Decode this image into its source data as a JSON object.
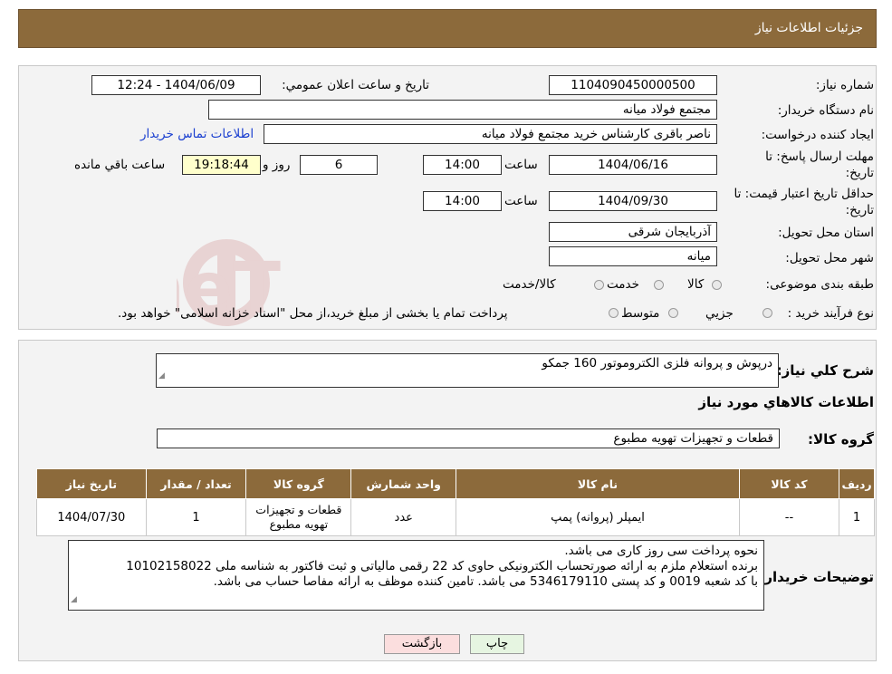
{
  "header": {
    "title": "جزئیات اطلاعات نیاز"
  },
  "form": {
    "need_number_label": "شماره نیاز:",
    "need_number": "1104090450000500",
    "announce_label": "تاریخ و ساعت اعلان عمومي:",
    "announce_value": "1404/06/09 - 12:24",
    "buyer_org_label": "نام دستگاه خريدار:",
    "buyer_org": "مجتمع فولاد میانه",
    "creator_label": "ايجاد کننده درخواست:",
    "creator": "ناصر باقری کارشناس خرید مجتمع فولاد میانه",
    "contact_link": "اطلاعات تماس خريدار",
    "deadline_label_1": "مهلت ارسال پاسخ: تا",
    "deadline_label_2": "تاريخ:",
    "deadline_date": "1404/06/16",
    "time_label": "ساعت",
    "deadline_time": "14:00",
    "days_value": "6",
    "days_label": "روز و",
    "remaining_time": "19:18:44",
    "remaining_label": "ساعت باقي مانده",
    "validity_label_1": "حداقل تاريخ اعتبار قيمت: تا",
    "validity_label_2": "تاريخ:",
    "validity_date": "1404/09/30",
    "validity_time": "14:00",
    "province_label": "استان محل تحويل:",
    "province": "آذربایجان شرقی",
    "city_label": "شهر محل تحويل:",
    "city": "میانه",
    "category_label": "طبقه بندی موضوعی:",
    "category_options": [
      "كالا",
      "خدمت",
      "كالا/خدمت"
    ],
    "process_label": "نوع فرآيند خريد :",
    "process_options": [
      "جزيي",
      "متوسط"
    ],
    "process_note": "پرداخت تمام يا بخشی از مبلغ خريد،از محل \"اسناد خزانه اسلامی\" خواهد بود."
  },
  "summary": {
    "desc_label": "شرح كلي نياز:",
    "desc": "درپوش و پروانه فلزی الکتروموتور 160 جمکو",
    "goods_info_title": "اطلاعات كالاهاي مورد نياز",
    "goods_group_label": "گروه كالا:",
    "goods_group": "قطعات و تجهیزات تهویه مطبوع"
  },
  "table": {
    "headers": [
      "رديف",
      "کد کالا",
      "نام کالا",
      "واحد شمارش",
      "گروه کالا",
      "تعداد / مقدار",
      "تاريخ نياز"
    ],
    "rows": [
      [
        "1",
        "--",
        "ایمپلر (پروانه) پمپ",
        "عدد",
        "قطعات و تجهیزات تهویه مطبوع",
        "1",
        "1404/07/30"
      ]
    ]
  },
  "buyer_notes": {
    "label": "توضيحات خريدار:",
    "lines": [
      "نحوه پرداخت سی روز کاری می باشد.",
      "برنده استعلام ملزم به ارائه صورتحساب الکترونیکی حاوی کد 22 رقمی مالیاتی و ثبت فاکتور به شناسه ملی 10102158022",
      "با کد شعبه 0019 و کد پستی 5346179110 می باشد. تامین کننده موظف به ارائه مفاصا حساب می باشد."
    ]
  },
  "buttons": {
    "print": "چاپ",
    "back": "بازگشت"
  },
  "watermark": "AriaTender.neT",
  "colors": {
    "header_bg": "#8c6a3b",
    "highlight": "#ffffcc",
    "link": "#1a3fd0",
    "back_button_bg": "#fbdede",
    "print_button_bg": "#e6f5e1"
  }
}
